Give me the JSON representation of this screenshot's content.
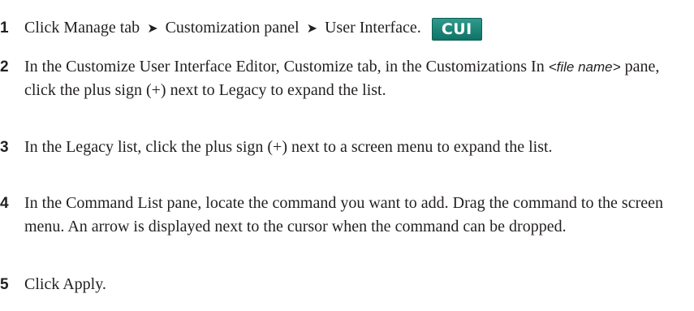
{
  "steps": [
    {
      "number": "1",
      "parts": [
        "Click Manage tab",
        "Customization panel",
        "User Interface."
      ],
      "arrow_glyph": "➤",
      "button_label": "CUI"
    },
    {
      "number": "2",
      "text_a": "In the Customize User Interface Editor, Customize tab, in the Customizations In ",
      "file_name": "<file name>",
      "text_b": " pane, click the plus sign (+) next to Legacy to expand the list."
    },
    {
      "number": "3",
      "text": "In the Legacy list, click the plus sign (+) next to a screen menu to expand the list."
    },
    {
      "number": "4",
      "text": "In the Command List pane, locate the command you want to add. Drag the command to the screen menu. An arrow is displayed next to the cursor when the command can be dropped."
    },
    {
      "number": "5",
      "text": "Click Apply."
    }
  ]
}
